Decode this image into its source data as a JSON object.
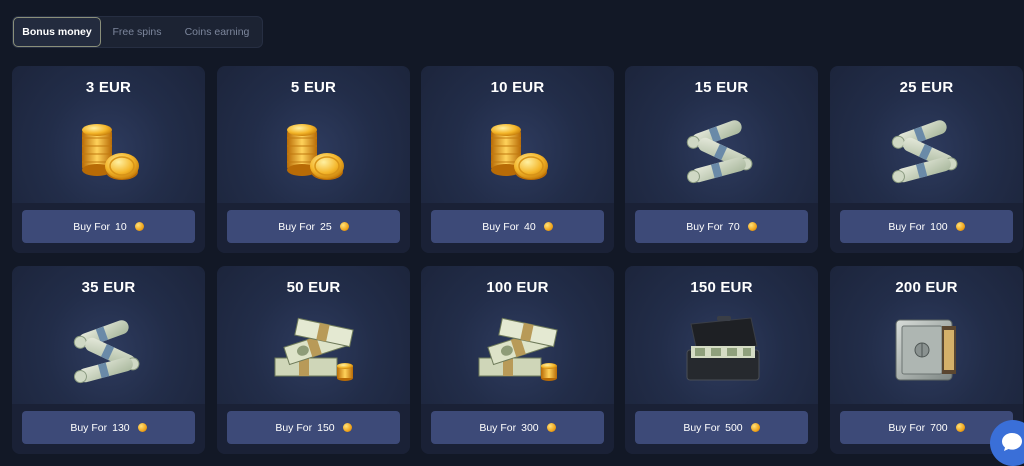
{
  "tabs": [
    {
      "label": "Bonus money",
      "active": true
    },
    {
      "label": "Free spins",
      "active": false
    },
    {
      "label": "Coins earning",
      "active": false
    }
  ],
  "packages": [
    {
      "title": "3 EUR",
      "buy_label": "Buy For",
      "price": "10",
      "icon": "gold-coins-icon"
    },
    {
      "title": "5 EUR",
      "buy_label": "Buy For",
      "price": "25",
      "icon": "gold-coins-icon"
    },
    {
      "title": "10 EUR",
      "buy_label": "Buy For",
      "price": "40",
      "icon": "gold-coins-icon"
    },
    {
      "title": "15 EUR",
      "buy_label": "Buy For",
      "price": "70",
      "icon": "cash-rolls-icon"
    },
    {
      "title": "25 EUR",
      "buy_label": "Buy For",
      "price": "100",
      "icon": "cash-rolls-icon"
    },
    {
      "title": "35 EUR",
      "buy_label": "Buy For",
      "price": "130",
      "icon": "cash-rolls-icon"
    },
    {
      "title": "50 EUR",
      "buy_label": "Buy For",
      "price": "150",
      "icon": "cash-stack-icon"
    },
    {
      "title": "100 EUR",
      "buy_label": "Buy For",
      "price": "300",
      "icon": "cash-stack-icon"
    },
    {
      "title": "150 EUR",
      "buy_label": "Buy For",
      "price": "500",
      "icon": "cash-briefcase-icon"
    },
    {
      "title": "200 EUR",
      "buy_label": "Buy For",
      "price": "700",
      "icon": "safe-icon"
    }
  ],
  "colors": {
    "background": "#121826",
    "card": "#222d49",
    "button": "#3d4a78",
    "coin": "#f0a51c",
    "chat": "#3a6fd8"
  },
  "chat_widget": {
    "icon": "chat-bubble-icon"
  }
}
